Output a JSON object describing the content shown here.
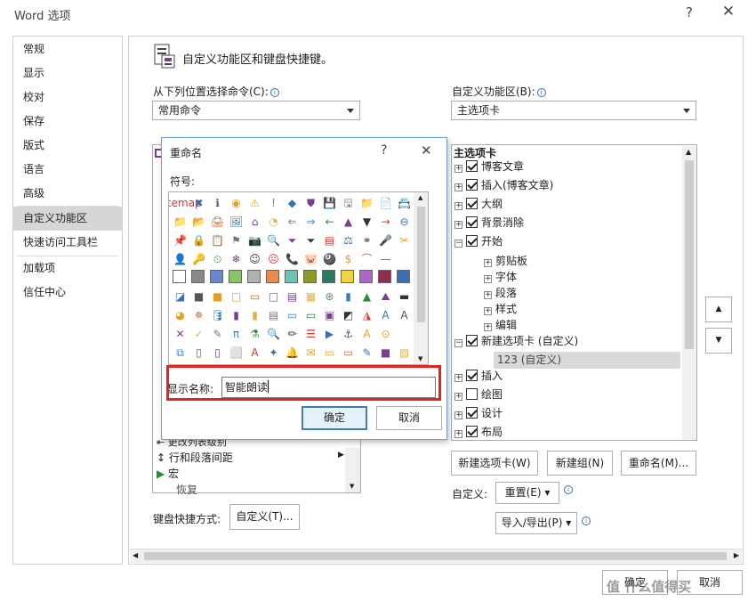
{
  "window": {
    "title": "Word 选项",
    "help_glyph": "?",
    "close_glyph": "✕"
  },
  "nav": {
    "items": [
      {
        "label": "常规"
      },
      {
        "label": "显示"
      },
      {
        "label": "校对"
      },
      {
        "label": "保存"
      },
      {
        "label": "版式"
      },
      {
        "label": "语言"
      },
      {
        "label": "高级"
      },
      {
        "label": "自定义功能区",
        "selected": true
      },
      {
        "label": "快速访问工具栏"
      },
      {
        "label": "加载项"
      },
      {
        "label": "信任中心"
      }
    ]
  },
  "header": {
    "title": "自定义功能区和键盘快捷键。"
  },
  "left": {
    "label": "从下列位置选择命令(C):",
    "combo_value": "常用命令",
    "visible_items": [
      "更改列表级别",
      "行和段落间距",
      "宏",
      "恢复"
    ]
  },
  "right": {
    "label": "自定义功能区(B):",
    "combo_value": "主选项卡",
    "tree_header": "主选项卡",
    "tree": [
      {
        "label": "博客文章",
        "checked": true,
        "level": 0
      },
      {
        "label": "插入(博客文章)",
        "checked": true,
        "level": 0
      },
      {
        "label": "大纲",
        "checked": true,
        "level": 0
      },
      {
        "label": "背景消除",
        "checked": true,
        "level": 0
      },
      {
        "label": "开始",
        "checked": true,
        "level": 0,
        "expanded": true
      },
      {
        "label": "剪贴板",
        "level": 1
      },
      {
        "label": "字体",
        "level": 1
      },
      {
        "label": "段落",
        "level": 1
      },
      {
        "label": "样式",
        "level": 1
      },
      {
        "label": "编辑",
        "level": 1
      },
      {
        "label": "新建选项卡 (自定义)",
        "checked": true,
        "level": 0
      },
      {
        "label": "123 (自定义)",
        "level": 1,
        "selected": true
      },
      {
        "label": "插入",
        "checked": true,
        "level": 0
      },
      {
        "label": "绘图",
        "checked": false,
        "level": 0
      },
      {
        "label": "设计",
        "checked": true,
        "level": 0
      },
      {
        "label": "布局",
        "checked": true,
        "level": 0
      }
    ],
    "buttons": {
      "new_tab": "新建选项卡(W)",
      "new_group": "新建组(N)",
      "rename": "重命名(M)..."
    },
    "customize_label": "自定义:",
    "reset": "重置(E) ▾",
    "import_export": "导入/导出(P) ▾"
  },
  "keyboard": {
    "label": "键盘快捷方式:",
    "button": "自定义(T)..."
  },
  "footer": {
    "ok": "确定",
    "cancel": "取消"
  },
  "watermark": "值 什么值得买",
  "rename_dialog": {
    "title": "重命名",
    "help_glyph": "?",
    "close_glyph": "✕",
    "symbol_label": "符号:",
    "display_name_label": "显示名称:",
    "display_name_value": "智能朗读",
    "ok": "确定",
    "cancel": "取消",
    "symbols": [
      [
        "sitemap",
        "✖",
        "ℹ",
        "◉",
        "⚠",
        "!",
        "◆",
        "⛊",
        "💾",
        "🖫",
        "📁",
        "📄",
        "📇",
        "📂"
      ],
      [
        "📁",
        "📂",
        "🖨",
        "🖼",
        "⌂",
        "◔",
        "⇐",
        "⇒",
        "←",
        "▲",
        "▼",
        "→",
        "⊖"
      ],
      [
        "📌",
        "🔒",
        "📋",
        "⚑",
        "📷",
        "🔍",
        "⏷",
        "⏷",
        "▤",
        "⚖",
        "⚭",
        "🎤",
        "✂"
      ],
      [
        "👤",
        "🔑",
        "⏲",
        "❄",
        "☺",
        "☹",
        "📞",
        "🐷",
        "🎱",
        "$",
        "⌒",
        "—"
      ],
      [
        "📊",
        "□",
        "■",
        "■",
        "■",
        "■",
        "■",
        "■",
        "■",
        "■",
        "■",
        "■",
        "■"
      ],
      [
        "◪",
        "■",
        "■",
        "□",
        "▭",
        "□",
        "▤",
        "▦",
        "⊛",
        "▮",
        "▲",
        "⛰",
        "▬"
      ],
      [
        "◕",
        "✵",
        "🛢",
        "▮",
        "▮",
        "▤",
        "▭",
        "▭",
        "▣",
        "◩",
        "◮",
        "A",
        "A"
      ],
      [
        "✕",
        "✓",
        "✎",
        "π",
        "⚗",
        "🔍",
        "✏",
        "☰",
        "▶",
        "⚓",
        "A",
        "⊙"
      ],
      [
        "⧉",
        "▯",
        "▯",
        "⬜",
        "A",
        "✦",
        "🔔",
        "✉",
        "▭",
        "▭",
        "✎",
        "■",
        "▨",
        "■"
      ]
    ]
  },
  "colors": {
    "accent": "#3c7fb1",
    "highlight_box": "#e32222",
    "nav_selected": "#d6d6d6"
  }
}
